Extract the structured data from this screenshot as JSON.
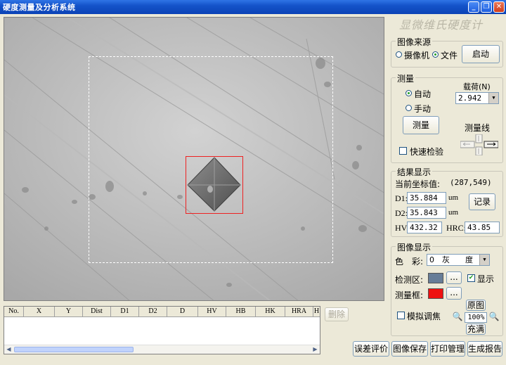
{
  "window": {
    "title": "硬度测量及分析系统"
  },
  "brand": "显微维氏硬度计",
  "image_source": {
    "title": "图像来源",
    "options": [
      "摄像机",
      "文件"
    ],
    "selected": "文件",
    "start_button": "启动"
  },
  "measure": {
    "title": "测量",
    "modes": [
      "自动",
      "手动"
    ],
    "selected": "自动",
    "load_label": "载荷(N)",
    "load_value": "2.942",
    "measure_button": "测量",
    "line_label": "测量线",
    "quick_check": "快速检验"
  },
  "results": {
    "title": "结果显示",
    "coord_label": "当前坐标值:",
    "coord_value": "(287,549)",
    "d1_label": "D1:",
    "d1_value": "35.884",
    "d2_label": "D2:",
    "d2_value": "35.843",
    "unit": "um",
    "record_button": "记录",
    "hv_label": "HV:",
    "hv_value": "432.32",
    "hrc_label": "HRC:",
    "hrc_value": "43.85"
  },
  "image_display": {
    "title": "图像显示",
    "color_label": "色　彩:",
    "color_value": "0　灰　　度",
    "detect_label": "检测区:",
    "detect_color": "#677d98",
    "show_label": "显示",
    "frame_label": "测量框:",
    "frame_color": "#ee1111",
    "ellipsis": "...",
    "simulate_label": "模拟调焦",
    "original_button": "原图",
    "zoom_value": "100%",
    "fill_button": "充满"
  },
  "table": {
    "columns": [
      "No.",
      "X",
      "Y",
      "Dist",
      "D1",
      "D2",
      "D",
      "HV",
      "HB",
      "HK",
      "HRA",
      "H"
    ],
    "delete_button": "删除"
  },
  "bottom_buttons": [
    "误差评价",
    "图像保存",
    "打印管理",
    "生成报告"
  ]
}
